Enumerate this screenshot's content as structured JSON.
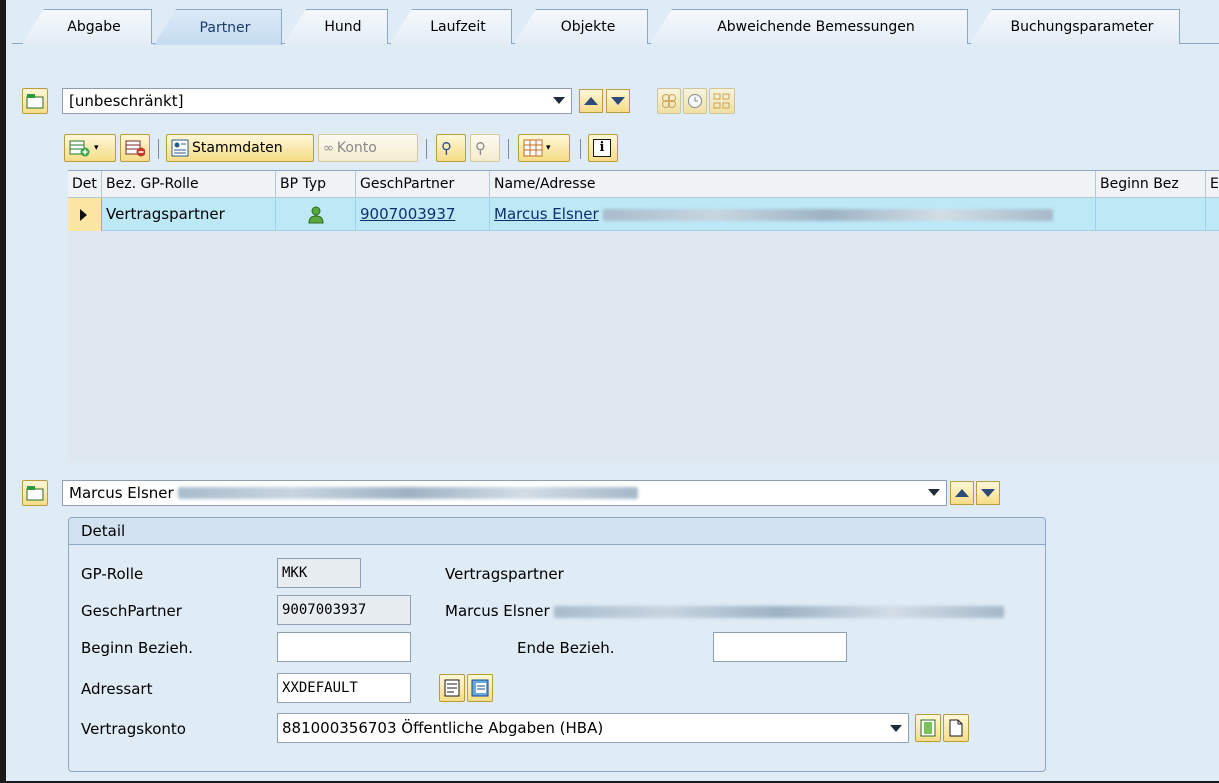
{
  "tabs": [
    {
      "label": "Abgabe"
    },
    {
      "label": "Partner"
    },
    {
      "label": "Hund"
    },
    {
      "label": "Laufzeit"
    },
    {
      "label": "Objekte"
    },
    {
      "label": "Abweichende Bemessungen"
    },
    {
      "label": "Buchungsparameter"
    }
  ],
  "active_tab": "Partner",
  "filter": {
    "value": "[unbeschränkt]"
  },
  "toolbar": {
    "stammdaten_label": "Stammdaten",
    "konto_label": "Konto"
  },
  "grid": {
    "columns": [
      "Det",
      "Bez. GP-Rolle",
      "BP Typ",
      "GeschPartner",
      "Name/Adresse",
      "Beginn Bez",
      "E"
    ],
    "rows": [
      {
        "role": "Vertragspartner",
        "partner": "9007003937",
        "name": "Marcus Elsner"
      }
    ]
  },
  "detail_select": {
    "value": "Marcus Elsner"
  },
  "detail": {
    "title": "Detail",
    "gp_rolle_label": "GP-Rolle",
    "gp_rolle_value": "MKK",
    "gp_rolle_text": "Vertragspartner",
    "partner_label": "GeschPartner",
    "partner_value": "9007003937",
    "partner_text": "Marcus Elsner",
    "beginn_label": "Beginn Bezieh.",
    "beginn_value": "",
    "ende_label": "Ende Bezieh.",
    "ende_value": "",
    "adressart_label": "Adressart",
    "adressart_value": "XXDEFAULT",
    "vk_label": "Vertragskonto",
    "vk_value": "881000356703 Öffentliche Abgaben (HBA)"
  }
}
